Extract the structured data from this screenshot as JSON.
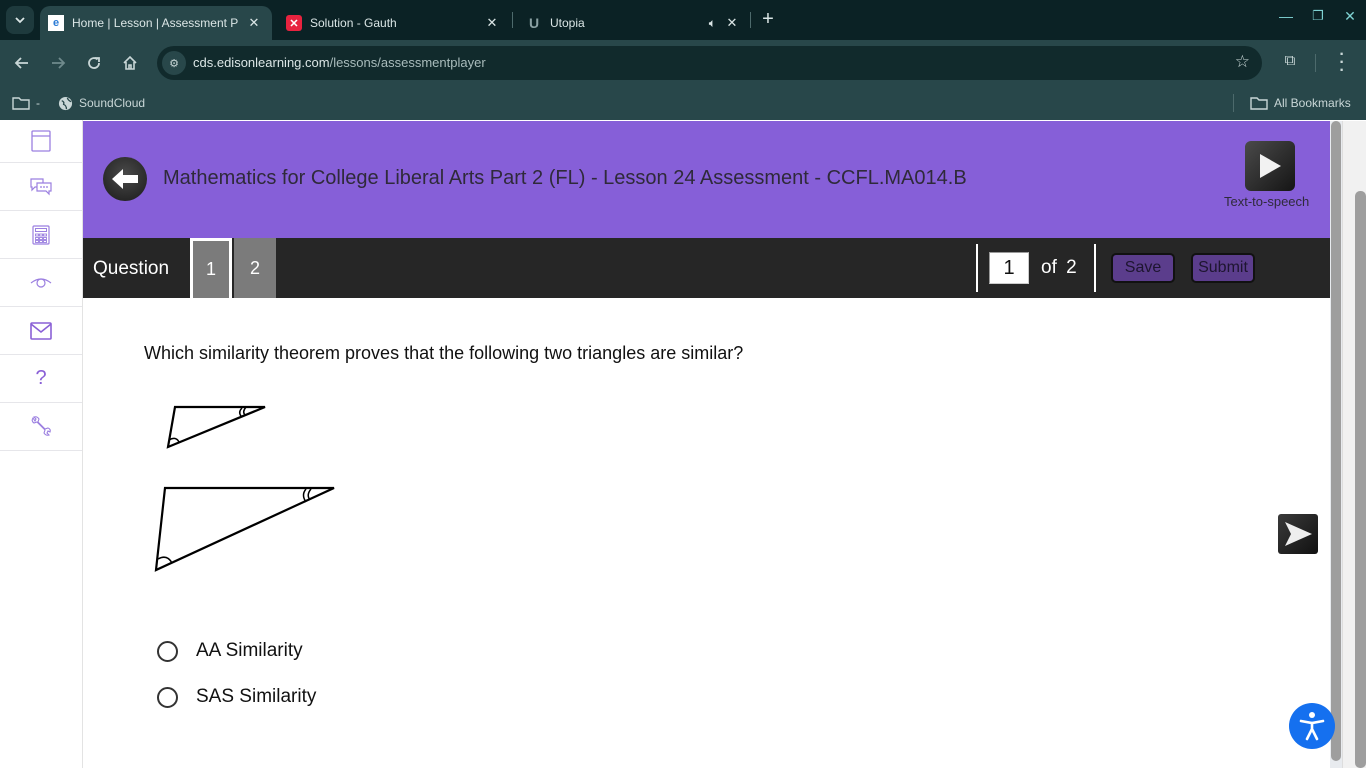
{
  "browser": {
    "tabs": [
      {
        "title": "Home | Lesson | Assessment P",
        "favicon": "edison-e-icon",
        "active": true
      },
      {
        "title": "Solution - Gauth",
        "favicon": "gauth-icon",
        "active": false
      },
      {
        "title": "Utopia",
        "favicon": "utopia-icon",
        "active": false,
        "audio": true
      }
    ],
    "url_host": "cds.edisonlearning.com",
    "url_path": "/lessons/assessmentplayer",
    "bookmarks": [
      {
        "label": "-",
        "icon": "folder-icon"
      },
      {
        "label": "SoundCloud",
        "icon": "globe-icon"
      }
    ],
    "all_bookmarks_label": "All Bookmarks"
  },
  "sidebar": {
    "items": [
      {
        "name": "notebook",
        "icon": "notebook-icon"
      },
      {
        "name": "messages",
        "icon": "chat-icon"
      },
      {
        "name": "calculator",
        "icon": "calculator-icon"
      },
      {
        "name": "view",
        "icon": "eye-icon"
      },
      {
        "name": "mail",
        "icon": "mail-icon"
      },
      {
        "name": "help",
        "icon": "help-icon"
      },
      {
        "name": "tools",
        "icon": "wrench-icon"
      }
    ]
  },
  "header": {
    "title": "Mathematics for College Liberal Arts Part 2 (FL) - Lesson 24 Assessment - CCFL.MA014.B",
    "tts_label": "Text-to-speech",
    "bg_color": "#865fd8"
  },
  "question_bar": {
    "label": "Question",
    "numbers": [
      "1",
      "2"
    ],
    "current": "1",
    "page_value": "1",
    "of_label": "of",
    "total": "2",
    "save_label": "Save",
    "submit_label": "Submit"
  },
  "question": {
    "text": "Which similarity theorem proves that the following two triangles are similar?",
    "choices": [
      {
        "label": "AA Similarity",
        "selected": false
      },
      {
        "label": "SAS Similarity",
        "selected": false
      }
    ]
  }
}
